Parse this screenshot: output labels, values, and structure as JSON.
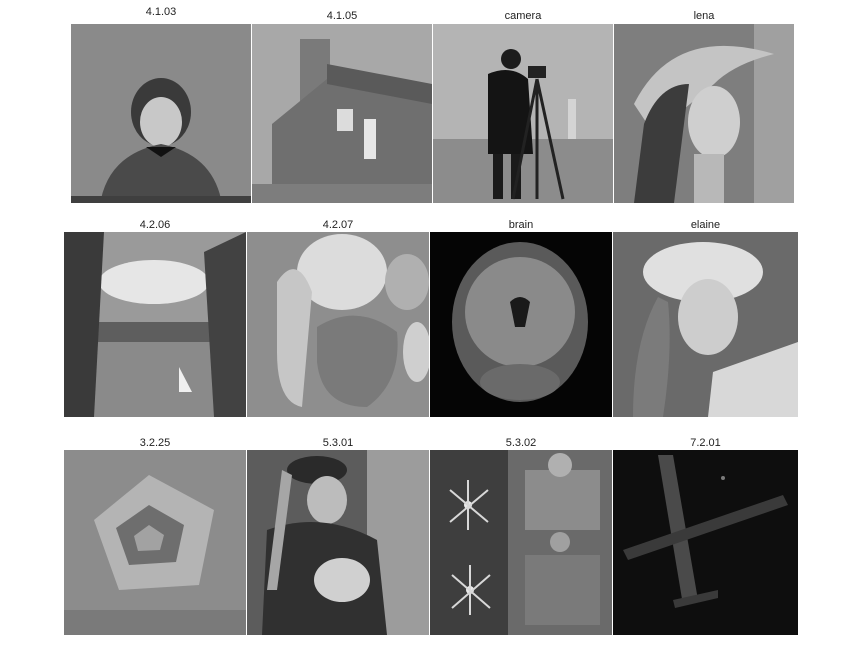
{
  "figure": {
    "rows": [
      {
        "tiles": [
          {
            "title": "4.1.03",
            "subject": "portrait-of-woman-icon"
          },
          {
            "title": "4.1.05",
            "subject": "house-icon"
          },
          {
            "title": "camera",
            "subject": "cameraman-icon"
          },
          {
            "title": "lena",
            "subject": "woman-with-hat-icon"
          }
        ]
      },
      {
        "tiles": [
          {
            "title": "4.2.06",
            "subject": "lake-with-sailboat-icon"
          },
          {
            "title": "4.2.07",
            "subject": "peppers-icon"
          },
          {
            "title": "brain",
            "subject": "brain-mri-icon"
          },
          {
            "title": "elaine",
            "subject": "woman-with-hat-icon"
          }
        ]
      },
      {
        "tiles": [
          {
            "title": "3.2.25",
            "subject": "pentagon-aerial-icon"
          },
          {
            "title": "5.3.01",
            "subject": "man-with-feathers-icon"
          },
          {
            "title": "5.3.02",
            "subject": "airport-aerial-icon"
          },
          {
            "title": "7.2.01",
            "subject": "airplane-night-icon"
          }
        ]
      }
    ]
  }
}
